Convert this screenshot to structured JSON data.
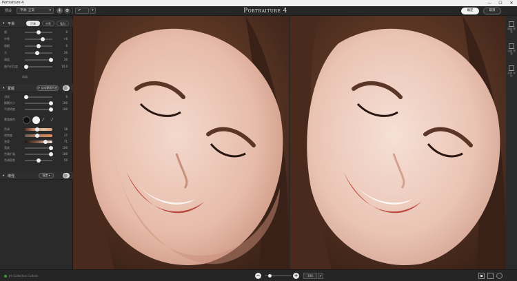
{
  "window": {
    "title": "Portraiture 4",
    "controls": [
      "—",
      "☐",
      "✕"
    ]
  },
  "toolbar": {
    "preset_label": "预设",
    "preset_value": "平滑: 正常",
    "add_label": "+",
    "options_label": "⚙",
    "undo_label": "↶",
    "undo_caret": "▾",
    "logo": "Portraiture 4",
    "ok_label": "确定",
    "cancel_label": "取消"
  },
  "smoothing": {
    "title": "平滑",
    "modes": [
      "正常",
      "中等",
      "强烈"
    ],
    "active_mode": "正常",
    "sliders": [
      {
        "label": "细",
        "value": "0",
        "pos": 0.5
      },
      {
        "label": "中等",
        "value": "+6",
        "pos": 0.65
      },
      {
        "label": "粗糙",
        "value": "0",
        "pos": 0.5
      },
      {
        "label": "大",
        "value": "20",
        "pos": 0.45
      },
      {
        "label": "阈值",
        "value": "20",
        "pos": 0.95
      },
      {
        "label": "细节对比度",
        "value": "10.0",
        "pos": 0.05
      }
    ],
    "foot": "高级"
  },
  "mask": {
    "title": "蒙版",
    "auto_label": "⟳ 自动蒙版开启",
    "sliders": [
      {
        "label": "羽化",
        "value": "0",
        "pos": 0.05
      },
      {
        "label": "模糊大小",
        "value": "100",
        "pos": 0.95
      },
      {
        "label": "不透明度",
        "value": "100",
        "pos": 0.95
      }
    ],
    "color_label": "蒙版颜色",
    "gradients": [
      {
        "label": "色调",
        "value": "18",
        "pos": 0.45
      },
      {
        "label": "饱和度",
        "value": "27",
        "pos": 0.45
      },
      {
        "label": "亮度",
        "value": "71",
        "pos": 0.75
      },
      {
        "label": "宽度",
        "value": "100",
        "pos": 0.95
      },
      {
        "label": "色域扩展",
        "value": "100",
        "pos": 0.95
      },
      {
        "label": "色调容差",
        "value": "50",
        "pos": 0.5
      }
    ]
  },
  "enhance": {
    "title": "增强",
    "mode_label": "强度 ▾"
  },
  "bottom": {
    "status": "Jm Collective Culture",
    "zoom_minus": "−",
    "zoom_plus": "+",
    "zoom_value": "100",
    "zoom_caret": "▾"
  },
  "right_panel": [
    {
      "label": "原始 预览"
    },
    {
      "label": "当前 预览"
    },
    {
      "label": "并排 对比"
    }
  ],
  "colors": {
    "accent": "#e8e8e8",
    "panel": "#2a2a2a",
    "background": "#232323"
  }
}
